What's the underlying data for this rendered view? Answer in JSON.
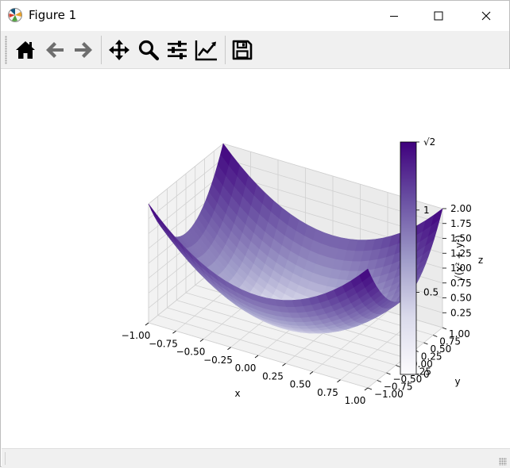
{
  "window": {
    "title": "Figure 1",
    "icons": {
      "app": "matplotlib-logo-icon",
      "minimize": "minimize-icon",
      "maximize": "maximize-icon",
      "close": "close-icon"
    }
  },
  "toolbar": {
    "items": [
      {
        "name": "home",
        "icon": "home-icon"
      },
      {
        "name": "back",
        "icon": "arrow-left-icon"
      },
      {
        "name": "forward",
        "icon": "arrow-right-icon"
      },
      {
        "name": "pan",
        "icon": "move-icon"
      },
      {
        "name": "zoom",
        "icon": "magnifier-icon"
      },
      {
        "name": "subplots",
        "icon": "sliders-icon"
      },
      {
        "name": "customize",
        "icon": "line-chart-icon"
      },
      {
        "name": "save",
        "icon": "floppy-disk-icon"
      }
    ]
  },
  "chart_data": {
    "type": "surface3d",
    "title": "",
    "function": "z = x^2 + y^2",
    "x_range": [
      -1,
      1
    ],
    "y_range": [
      -1,
      1
    ],
    "z_range": [
      0,
      2
    ],
    "xlabel": "x",
    "ylabel": "y",
    "zlabel": "z",
    "x_ticks": [
      "−1.00",
      "−0.75",
      "−0.50",
      "−0.25",
      "0.00",
      "0.25",
      "0.50",
      "0.75",
      "1.00"
    ],
    "y_ticks": [
      "−1.00",
      "−0.75",
      "−0.50",
      "−0.25",
      "0.00",
      "0.25",
      "0.50",
      "0.75",
      "1.00"
    ],
    "z_ticks": [
      "0.25",
      "0.50",
      "0.75",
      "1.00",
      "1.25",
      "1.50",
      "1.75",
      "2.00"
    ],
    "colormap": "Purples",
    "color_low": "#fcfbfd",
    "color_high": "#3f007d",
    "grid": true,
    "colorbar": {
      "label": "√(x² + y²)",
      "range": [
        0,
        1.41421356
      ],
      "tick_values": [
        0,
        0.5,
        1,
        1.41421356
      ],
      "tick_labels": [
        "0",
        "0.5",
        "1",
        "√2"
      ]
    }
  }
}
